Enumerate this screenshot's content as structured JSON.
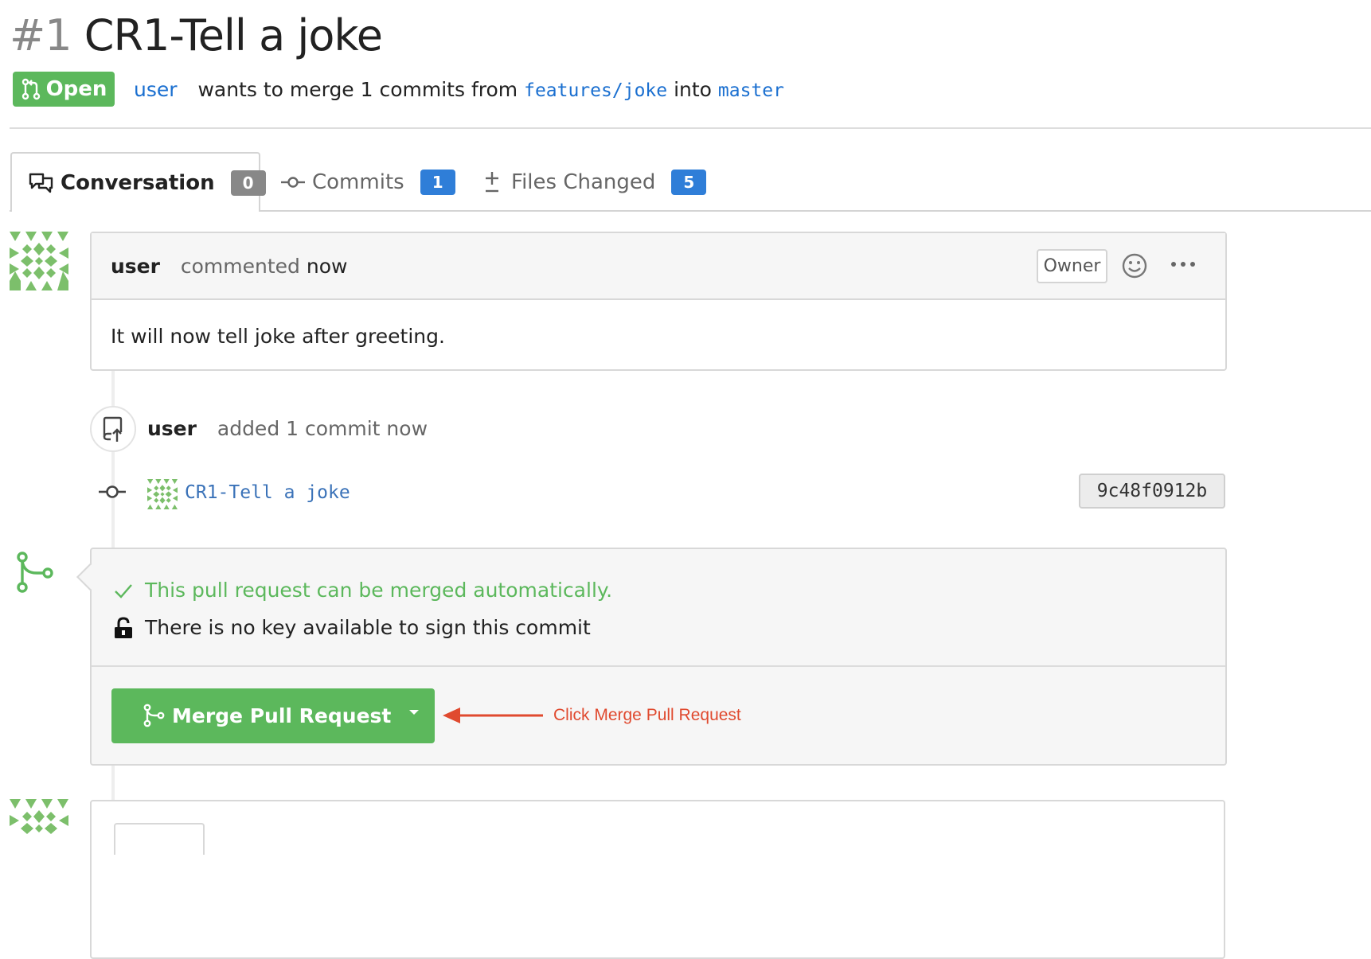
{
  "pull_request": {
    "number": "#1",
    "title": "CR1-Tell a joke",
    "status": "Open",
    "author": "user",
    "merge_text": "wants to merge 1 commits from",
    "source_branch": "features/joke",
    "into_text": "into",
    "target_branch": "master"
  },
  "tabs": [
    {
      "label": "Conversation",
      "count": "0"
    },
    {
      "label": "Commits",
      "count": "1"
    },
    {
      "label": "Files Changed",
      "count": "5"
    }
  ],
  "comment": {
    "author": "user",
    "action": "commented",
    "time": "now",
    "role": "Owner",
    "body": "It will now tell joke after greeting."
  },
  "commit_event": {
    "author": "user",
    "action": "added 1 commit now",
    "commit_message": "CR1-Tell a joke",
    "sha": "9c48f0912b"
  },
  "merge": {
    "status_ok": "This pull request can be merged automatically.",
    "signing_notice": "There is no key available to sign this commit",
    "button_label": "Merge Pull Request"
  },
  "annotation": {
    "text": "Click Merge Pull Request"
  },
  "colors": {
    "green": "#5cb85c",
    "blue_badge": "#2f7ed8",
    "link": "#1a6fd0",
    "annotation_red": "#e04a2f"
  }
}
